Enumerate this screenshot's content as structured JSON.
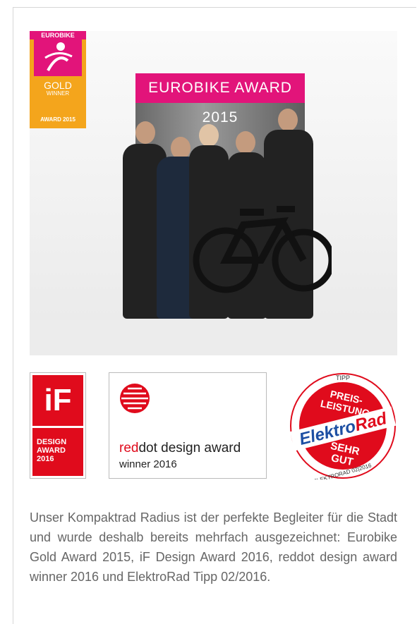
{
  "photo": {
    "banner_text": "EUROBIKE AWARD 2015"
  },
  "eurobike_badge": {
    "brand": "EUROBIKE",
    "gold": "GOLD",
    "winner": "WINNER",
    "award": "AWARD 2015",
    "colors": {
      "pink": "#e2147a",
      "gold": "#f4a51c"
    }
  },
  "if_award": {
    "logo": "iF",
    "line1": "DESIGN",
    "line2": "AWARD",
    "line3": "2016",
    "color": "#e00b1c"
  },
  "reddot_award": {
    "red_part": "red",
    "dot_part": "dot",
    "rest": " design award",
    "winner": "winner 2016"
  },
  "elektrorad_seal": {
    "tipp": "TIPP",
    "preis": "PREIS-",
    "leistung": "LEISTUNG",
    "elektro": "Elektro",
    "rad": "Rad",
    "sehr": "SEHR",
    "gut": "GUT",
    "issue": "ELEKTRORAD 02|2016"
  },
  "description": "Unser Kompaktrad Radius ist der perfekte Begleiter für die Stadt und wurde deshalb bereits mehrfach ausgezeichnet: Eurobike Gold Award 2015, iF Design Award 2016, reddot design award winner 2016 und ElektroRad Tipp 02/2016."
}
